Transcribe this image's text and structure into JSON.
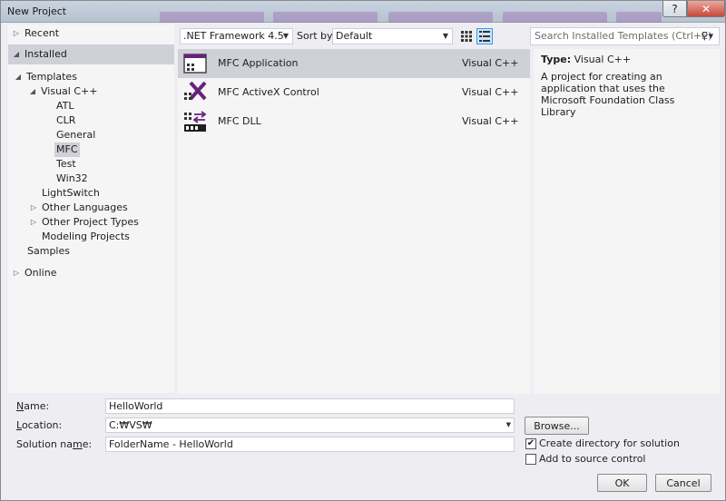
{
  "window": {
    "title": "New Project",
    "help_label": "?",
    "close_label": "✕"
  },
  "nav": {
    "recent": "Recent",
    "installed": "Installed",
    "templates": "Templates",
    "visual_cpp": "Visual C++",
    "atl": "ATL",
    "clr": "CLR",
    "general": "General",
    "mfc": "MFC",
    "test": "Test",
    "win32": "Win32",
    "lightswitch": "LightSwitch",
    "other_languages": "Other Languages",
    "other_project_types": "Other Project Types",
    "modeling_projects": "Modeling Projects",
    "samples": "Samples",
    "online": "Online"
  },
  "toolbar": {
    "framework": ".NET Framework 4.5",
    "sort_by_label": "Sort by:",
    "sort_by_value": "Default",
    "search_placeholder": "Search Installed Templates (Ctrl+E)"
  },
  "templates": [
    {
      "name": "MFC Application",
      "lang": "Visual C++",
      "icon": "mfc-application-icon"
    },
    {
      "name": "MFC ActiveX Control",
      "lang": "Visual C++",
      "icon": "mfc-activex-icon"
    },
    {
      "name": "MFC DLL",
      "lang": "Visual C++",
      "icon": "mfc-dll-icon"
    }
  ],
  "description": {
    "type_label": "Type:",
    "type_value": "Visual C++",
    "text": "A project for creating an application that uses the Microsoft Foundation Class Library"
  },
  "form": {
    "name_label": "Name:",
    "name_value": "HelloWorld",
    "location_label": "Location:",
    "location_value": "C:₩VS₩",
    "solution_label": "Solution name:",
    "solution_value": "FolderName - HelloWorld",
    "browse_label": "Browse...",
    "create_dir_label": "Create directory for solution",
    "create_dir_checked": true,
    "source_control_label": "Add to source control",
    "source_control_checked": false,
    "ok_label": "OK",
    "cancel_label": "Cancel"
  },
  "colors": {
    "accent": "#68217a",
    "selection": "#cfd0d8"
  }
}
